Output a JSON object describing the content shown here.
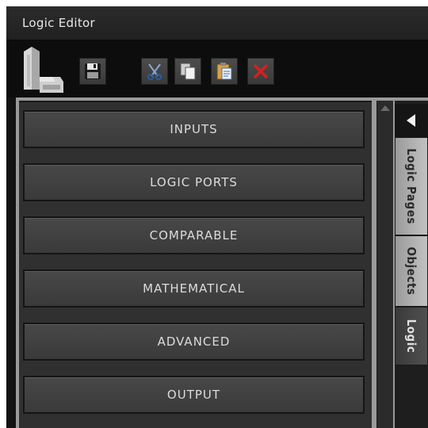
{
  "window": {
    "title": "Logic Editor"
  },
  "toolbar": {
    "logo_icon": "building-logo-icon",
    "buttons": [
      {
        "id": "save",
        "icon": "floppy-disk-icon"
      },
      {
        "id": "cut",
        "icon": "scissors-icon"
      },
      {
        "id": "copy",
        "icon": "copy-icon"
      },
      {
        "id": "paste",
        "icon": "clipboard-icon"
      },
      {
        "id": "delete",
        "icon": "red-x-icon",
        "color": "#d42020"
      }
    ]
  },
  "categories": [
    {
      "label": "INPUTS"
    },
    {
      "label": "LOGIC PORTS"
    },
    {
      "label": "COMPARABLE"
    },
    {
      "label": "MATHEMATICAL"
    },
    {
      "label": "ADVANCED"
    },
    {
      "label": "OUTPUT"
    }
  ],
  "side_tabs": {
    "collapse_icon": "triangle-left-icon",
    "tabs": [
      {
        "label": "Logic Pages",
        "active": false
      },
      {
        "label": "Objects",
        "active": false
      },
      {
        "label": "Logic",
        "active": true
      }
    ]
  },
  "colors": {
    "background": "#121212",
    "button": "#444444",
    "active_tab": "#464646",
    "inactive_tab": "#b4b4b4"
  }
}
